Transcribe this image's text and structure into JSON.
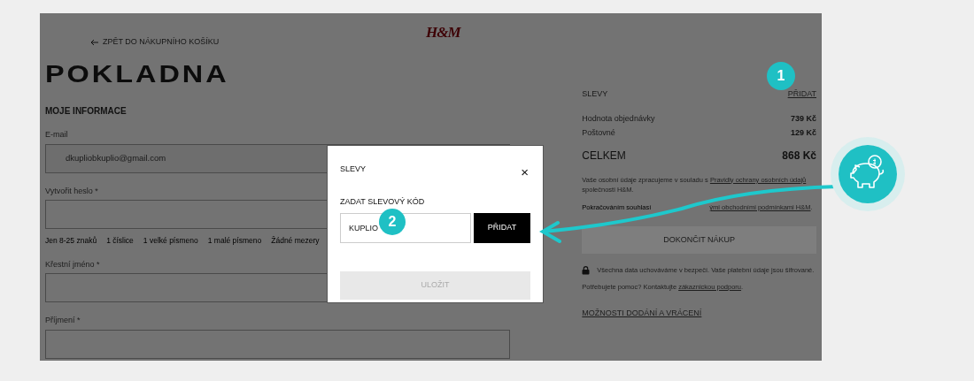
{
  "header": {
    "back_link": "ZPĚT DO NÁKUPNÍHO KOŠÍKU",
    "logo": "H&M"
  },
  "page_title": "POKLADNA",
  "section_title": "MOJE INFORMACE",
  "fields": [
    {
      "label": "E-mail",
      "value": "dkupliobkuplio@gmail.com"
    },
    {
      "label": "Vytvořit heslo *",
      "hints": [
        "Jen 8-25 znaků",
        "1 číslice",
        "1 velké písmeno",
        "1 malé písmeno",
        "Žádné mezery"
      ]
    },
    {
      "label": "Křestní jméno *"
    },
    {
      "label": "Příjmení *"
    }
  ],
  "summary": {
    "discounts_label": "SLEVY",
    "add_link": "PŘIDAT",
    "lines": [
      {
        "label": "Hodnota objednávky",
        "amount": "739 Kč"
      },
      {
        "label": "Poštovné",
        "amount": "129 Kč"
      }
    ],
    "total": {
      "label": "CELKEM",
      "amount": "868 Kč"
    },
    "privacy_note": {
      "text": "Vaše osobní údaje zpracujeme v souladu s ",
      "link": "Pravidly ochrany osobních údajů",
      "after": " společnosti H&M."
    },
    "terms_note": {
      "text": "Pokračováním souhlasí",
      "link": "ými obchodními podmínkami H&M",
      "after": "."
    },
    "checkout_button": {
      "label": "DOKONČIT NÁKUP",
      "disabled": true
    },
    "security_note": "Všechna data uchováváme v bezpečí. Vaše platební údaje jsou šifrované.",
    "help_note": {
      "text": "Potřebujete pomoc? Kontaktujte ",
      "link": "zákaznickou podporu",
      "after": "."
    },
    "delivery_link": "MOŽNOSTI DODÁNÍ A VRÁCENÍ"
  },
  "modal": {
    "title": "SLEVY",
    "close": "×",
    "code_label": "ZADAT SLEVOVÝ KÓD",
    "code_value": "KUPLIO",
    "add_button": "PŘIDAT",
    "save_button": {
      "label": "ULOŽIT",
      "disabled": true
    }
  },
  "annotations": [
    {
      "label": "1"
    },
    {
      "label": "2"
    }
  ]
}
